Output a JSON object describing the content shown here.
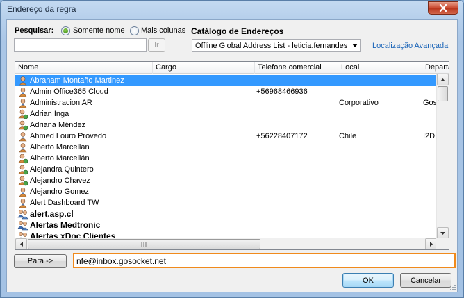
{
  "window": {
    "title": "Endereço da regra",
    "close_label": "x"
  },
  "search": {
    "label": "Pesquisar:",
    "option_name": "Somente nome",
    "option_more": "Mais colunas",
    "value": "",
    "go_label": "Ir"
  },
  "catalog": {
    "label": "Catálogo de Endereços",
    "selected": "Offline Global Address List - leticia.fernandes",
    "advanced_link": "Localização Avançada"
  },
  "table": {
    "columns": [
      "Nome",
      "Cargo",
      "Telefone comercial",
      "Local",
      "Departa"
    ],
    "rows": [
      {
        "name": "Abraham Montaño Martinez",
        "title": "",
        "phone": "",
        "location": "",
        "dept": "",
        "icon": "user-icon",
        "bold": false,
        "selected": true
      },
      {
        "name": "Admin Office365 Cloud",
        "title": "",
        "phone": "+56968466936",
        "location": "",
        "dept": "",
        "icon": "user-icon",
        "bold": false,
        "selected": false
      },
      {
        "name": "Administracion AR",
        "title": "",
        "phone": "",
        "location": "Corporativo",
        "dept": "Goso",
        "icon": "user-icon",
        "bold": false,
        "selected": false
      },
      {
        "name": "Adrian Inga",
        "title": "",
        "phone": "",
        "location": "",
        "dept": "",
        "icon": "contact-icon",
        "bold": false,
        "selected": false
      },
      {
        "name": "Adriana Méndez",
        "title": "",
        "phone": "",
        "location": "",
        "dept": "",
        "icon": "contact-icon",
        "bold": false,
        "selected": false
      },
      {
        "name": "Ahmed Louro Provedo",
        "title": "",
        "phone": "+56228407172",
        "location": "Chile",
        "dept": "I2D",
        "icon": "user-icon",
        "bold": false,
        "selected": false
      },
      {
        "name": "Alberto Marcellan",
        "title": "",
        "phone": "",
        "location": "",
        "dept": "",
        "icon": "user-icon",
        "bold": false,
        "selected": false
      },
      {
        "name": "Alberto Marcellán",
        "title": "",
        "phone": "",
        "location": "",
        "dept": "",
        "icon": "contact-icon",
        "bold": false,
        "selected": false
      },
      {
        "name": "Alejandra Quintero",
        "title": "",
        "phone": "",
        "location": "",
        "dept": "",
        "icon": "contact-icon",
        "bold": false,
        "selected": false
      },
      {
        "name": "Alejandro Chavez",
        "title": "",
        "phone": "",
        "location": "",
        "dept": "",
        "icon": "contact-icon",
        "bold": false,
        "selected": false
      },
      {
        "name": "Alejandro Gomez",
        "title": "",
        "phone": "",
        "location": "",
        "dept": "",
        "icon": "user-icon",
        "bold": false,
        "selected": false
      },
      {
        "name": "Alert Dashboard TW",
        "title": "",
        "phone": "",
        "location": "",
        "dept": "",
        "icon": "user-icon",
        "bold": false,
        "selected": false
      },
      {
        "name": "alert.asp.cl",
        "title": "",
        "phone": "",
        "location": "",
        "dept": "",
        "icon": "group-icon",
        "bold": true,
        "selected": false
      },
      {
        "name": "Alertas Medtronic",
        "title": "",
        "phone": "",
        "location": "",
        "dept": "",
        "icon": "group-icon",
        "bold": true,
        "selected": false
      },
      {
        "name": "Alertas xDoc Clientes",
        "title": "",
        "phone": "",
        "location": "",
        "dept": "",
        "icon": "group-icon",
        "bold": true,
        "selected": false
      }
    ]
  },
  "to": {
    "button_label": "Para ->",
    "value": "nfe@inbox.gosocket.net"
  },
  "footer": {
    "ok_label": "OK",
    "cancel_label": "Cancelar"
  },
  "colors": {
    "accent": "#3399ff",
    "focus_border": "#f08a1c",
    "link": "#1a64b8",
    "close": "#c9462c"
  }
}
